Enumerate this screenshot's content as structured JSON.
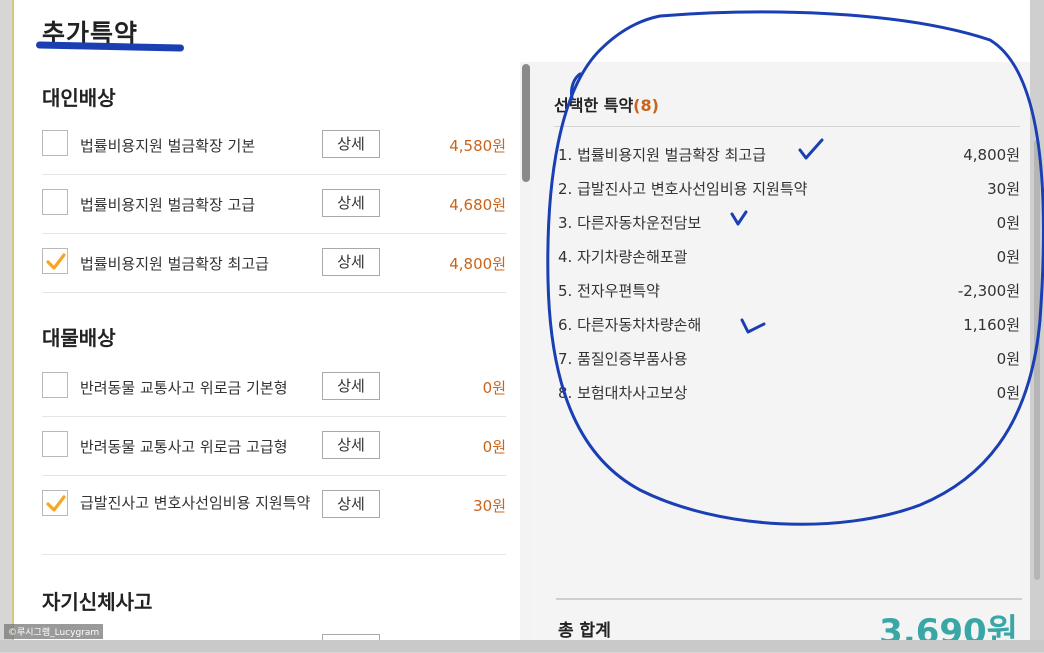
{
  "header": {
    "title": "추가특약"
  },
  "sections": [
    {
      "title": "대인배상",
      "items": [
        {
          "label": "법률비용지원 벌금확장 기본",
          "detail": "상세",
          "price": "4,580원",
          "checked": false
        },
        {
          "label": "법률비용지원 벌금확장 고급",
          "detail": "상세",
          "price": "4,680원",
          "checked": false
        },
        {
          "label": "법률비용지원 벌금확장 최고급",
          "detail": "상세",
          "price": "4,800원",
          "checked": true
        }
      ]
    },
    {
      "title": "대물배상",
      "items": [
        {
          "label": "반려동물 교통사고 위로금 기본형",
          "detail": "상세",
          "price": "0원",
          "checked": false
        },
        {
          "label": "반려동물 교통사고 위로금 고급형",
          "detail": "상세",
          "price": "0원",
          "checked": false
        },
        {
          "label": "급발진사고 변호사선임비용 지원특약",
          "detail": "상세",
          "price": "30원",
          "checked": true
        }
      ]
    },
    {
      "title": "자기신체사고",
      "items": []
    }
  ],
  "selected": {
    "title": "선택한 특약",
    "count": "(8)",
    "items": [
      {
        "name": "1. 법률비용지원 벌금확장 최고급",
        "price": "4,800원"
      },
      {
        "name": "2. 급발진사고 변호사선임비용 지원특약",
        "price": "30원"
      },
      {
        "name": "3. 다른자동차운전담보",
        "price": "0원"
      },
      {
        "name": "4. 자기차량손해포괄",
        "price": "0원"
      },
      {
        "name": "5. 전자우편특약",
        "price": "-2,300원"
      },
      {
        "name": "6. 다른자동차차량손해",
        "price": "1,160원"
      },
      {
        "name": "7. 품질인증부품사용",
        "price": "0원"
      },
      {
        "name": "8. 보험대차사고보상",
        "price": "0원"
      }
    ]
  },
  "total": {
    "label": "총 합계",
    "value": "3,690원"
  },
  "watermark": "©루시그램_Lucygram",
  "colors": {
    "accent": "#c8641b",
    "total": "#3aa6a6",
    "check": "#f5a623",
    "marker": "#1a3fb3"
  }
}
